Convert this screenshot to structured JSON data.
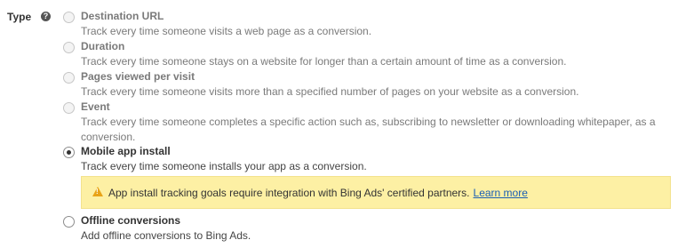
{
  "field_label": "Type",
  "help_icon": "question-circle-icon",
  "options": [
    {
      "title": "Destination URL",
      "description": "Track every time someone visits a web page as a conversion.",
      "state": "disabled"
    },
    {
      "title": "Duration",
      "description": "Track every time someone stays on a website for longer than a certain amount of time as a conversion.",
      "state": "disabled"
    },
    {
      "title": "Pages viewed per visit",
      "description": "Track every time someone visits more than a specified number of pages on your website as a conversion.",
      "state": "disabled"
    },
    {
      "title": "Event",
      "description_line1": "Track every time someone completes a specific action such as, subscribing to newsletter or downloading whitepaper, as a",
      "description_line2": "conversion.",
      "state": "disabled"
    },
    {
      "title": "Mobile app install",
      "description": "Track every time someone installs your app as a conversion.",
      "state": "selected"
    },
    {
      "title": "Offline conversions",
      "description": "Add offline conversions to Bing Ads.",
      "state": "enabled"
    }
  ],
  "warning": {
    "icon": "warning-triangle-icon",
    "text": "App install tracking goals require integration with Bing Ads' certified partners.",
    "link_text": "Learn more",
    "background_color": "#fdf0a4"
  }
}
